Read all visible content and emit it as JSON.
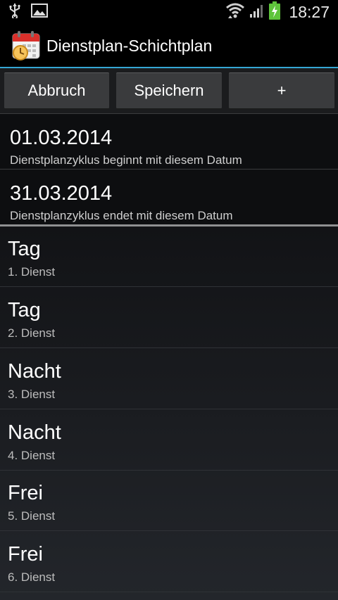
{
  "statusbar": {
    "time": "18:27",
    "icons": [
      "usb-icon",
      "image-icon",
      "wifi-icon",
      "signal-icon",
      "battery-charging-icon"
    ]
  },
  "app": {
    "title": "Dienstplan-Schichtplan",
    "icon": "calendar-clock-icon"
  },
  "buttons": {
    "cancel": "Abbruch",
    "save": "Speichern",
    "add": "+"
  },
  "dates": [
    {
      "value": "01.03.2014",
      "caption": "Dienstplanzyklus beginnt mit diesem Datum"
    },
    {
      "value": "31.03.2014",
      "caption": "Dienstplanzyklus endet mit diesem Datum"
    }
  ],
  "duties": [
    {
      "name": "Tag",
      "caption": "1. Dienst"
    },
    {
      "name": "Tag",
      "caption": "2. Dienst"
    },
    {
      "name": "Nacht",
      "caption": "3. Dienst"
    },
    {
      "name": "Nacht",
      "caption": "4. Dienst"
    },
    {
      "name": "Frei",
      "caption": "5. Dienst"
    },
    {
      "name": "Frei",
      "caption": "6. Dienst"
    }
  ],
  "colors": {
    "accent": "#35a6d4",
    "battery": "#5ec43b",
    "calendar_red": "#d9302b"
  }
}
